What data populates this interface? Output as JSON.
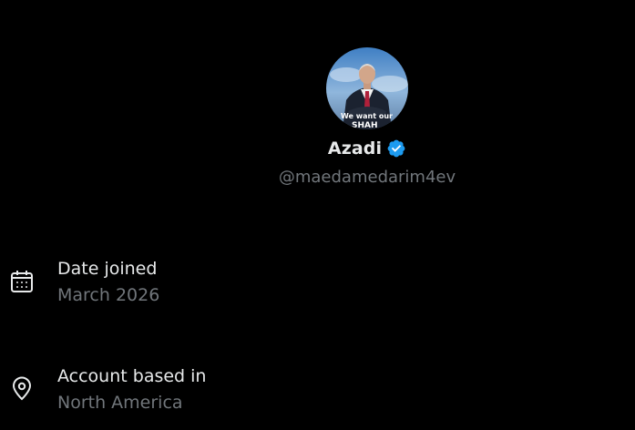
{
  "profile": {
    "display_name": "Azadi",
    "handle": "@maedamedarim4ev",
    "verified": true,
    "avatar_caption": "We want our SHAH",
    "verified_color": "#1d9bf0"
  },
  "details": {
    "joined_label": "Date joined",
    "joined_value": "March 2026",
    "joined_icon": "calendar-icon",
    "location_label": "Account based in",
    "location_value": "North America",
    "location_icon": "location-pin-icon"
  },
  "colors": {
    "background": "#000000",
    "primary_text": "#e7e9ea",
    "secondary_text": "#71767b"
  }
}
